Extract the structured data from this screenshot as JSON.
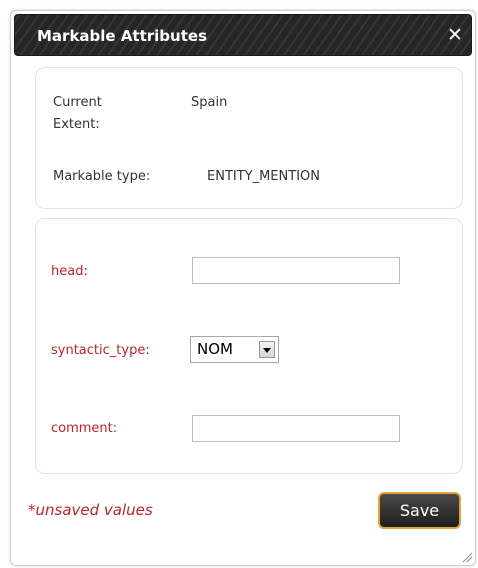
{
  "dialog": {
    "title": "Markable Attributes",
    "close_icon": "close-icon"
  },
  "info": {
    "extent_label": "Current Extent:",
    "extent_value": "Spain",
    "type_label": "Markable type:",
    "type_value": "ENTITY_MENTION"
  },
  "form": {
    "head": {
      "label": "head:",
      "value": ""
    },
    "syntactic_type": {
      "label": "syntactic_type:",
      "selected": "NOM"
    },
    "comment": {
      "label": "comment:",
      "value": ""
    }
  },
  "footer": {
    "unsaved_text": "*unsaved values",
    "save_label": "Save"
  },
  "colors": {
    "required_label": "#c0242a",
    "save_border": "#e4a43a",
    "titlebar": "#2e2e2e"
  }
}
